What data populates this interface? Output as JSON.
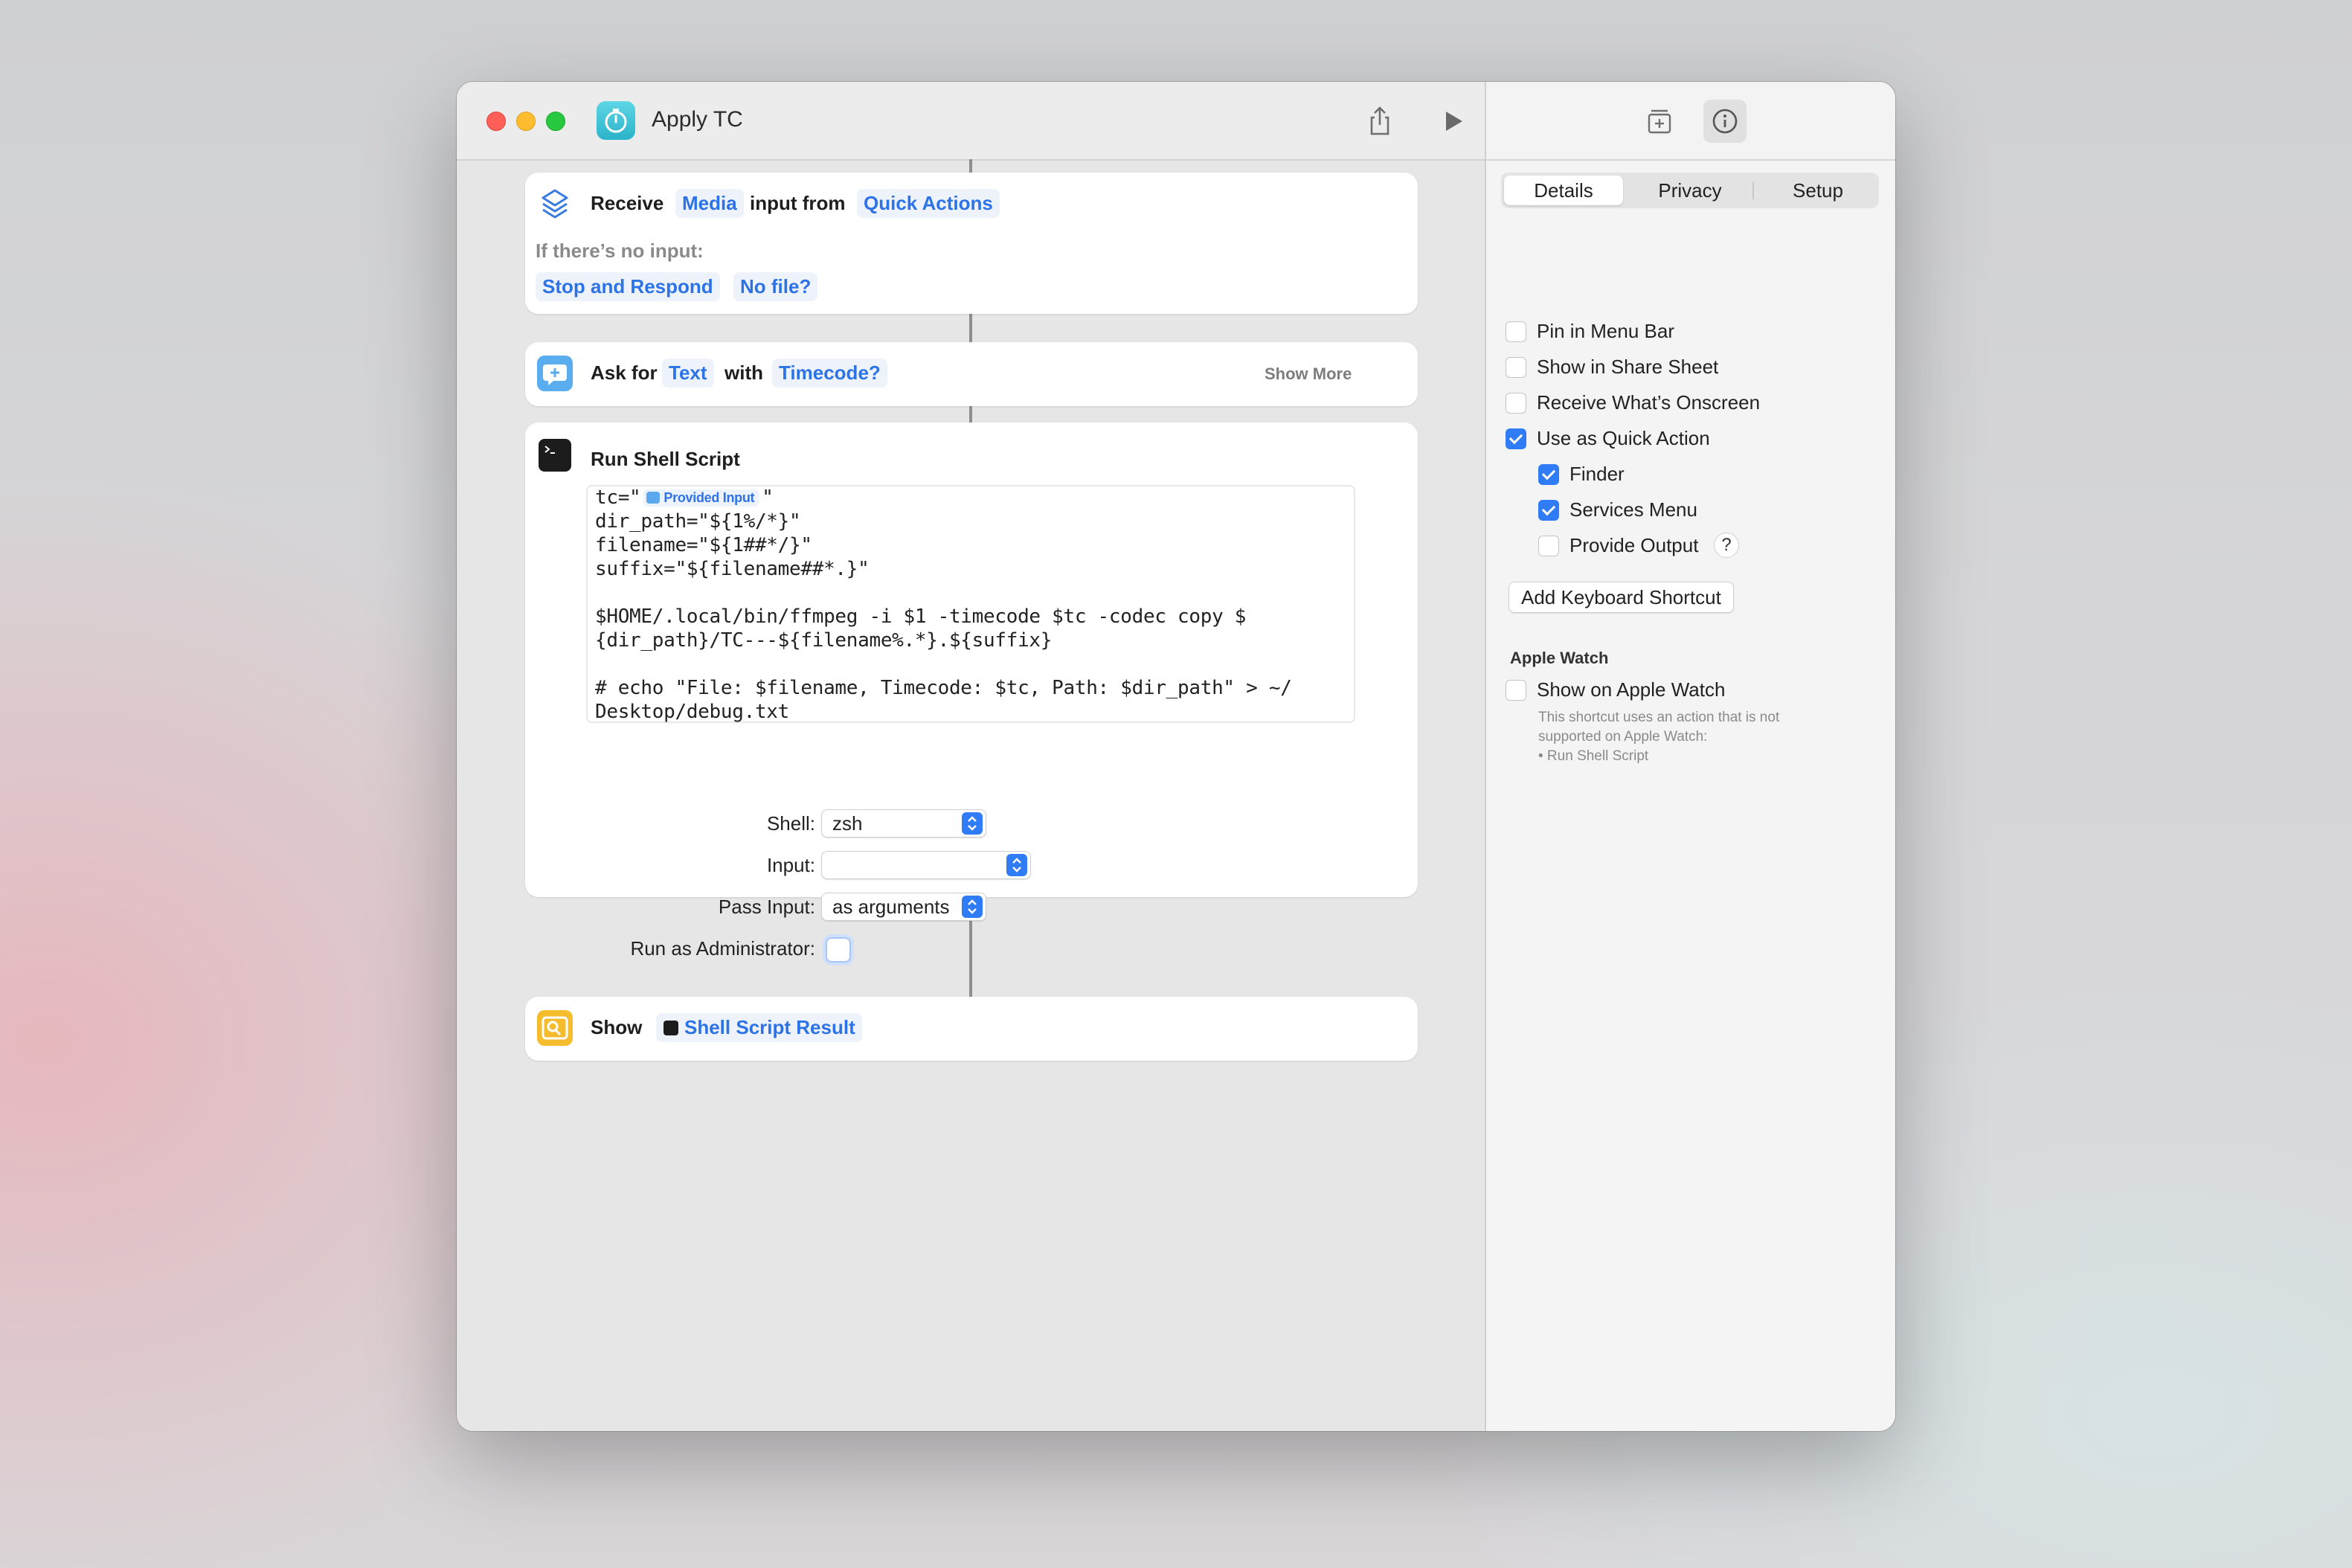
{
  "window": {
    "title": "Apply TC"
  },
  "actions": {
    "receive": {
      "label": "Receive",
      "type_token": "Media",
      "from_label": "input from",
      "source_token": "Quick Actions",
      "no_input_label": "If there’s no input:",
      "stop_token": "Stop and Respond",
      "no_file_token": "No file?"
    },
    "ask": {
      "label": "Ask for",
      "type_token": "Text",
      "with_label": "with",
      "prompt_token": "Timecode?",
      "show_more": "Show More"
    },
    "shell": {
      "title": "Run Shell Script",
      "code": {
        "line1_pre": "tc=\"",
        "line1_badge": "Provided Input",
        "line1_post": "\"",
        "line2": "dir_path=\"${1%/*}\"",
        "line3": "filename=\"${1##*/}\"",
        "line4": "suffix=\"${filename##*.}\"",
        "line5": "$HOME/.local/bin/ffmpeg -i $1 -timecode $tc -codec copy $",
        "line6": "{dir_path}/TC---${filename%.*}.${suffix}",
        "line7": "# echo \"File: $filename, Timecode: $tc, Path: $dir_path\" > ~/",
        "line8": "Desktop/debug.txt"
      },
      "shell_label": "Shell:",
      "shell_value": "zsh",
      "input_label": "Input:",
      "input_value": "",
      "pass_label": "Pass Input:",
      "pass_value": "as arguments",
      "admin_label": "Run as Administrator:"
    },
    "show": {
      "label": "Show",
      "token": "Shell Script Result"
    }
  },
  "sidebar": {
    "tabs": [
      "Details",
      "Privacy",
      "Setup"
    ],
    "active_tab": "Details",
    "options": [
      {
        "label": "Pin in Menu Bar",
        "checked": false
      },
      {
        "label": "Show in Share Sheet",
        "checked": false
      },
      {
        "label": "Receive What’s Onscreen",
        "checked": false
      },
      {
        "label": "Use as Quick Action",
        "checked": true
      },
      {
        "label": "Finder",
        "checked": true
      },
      {
        "label": "Services Menu",
        "checked": true
      },
      {
        "label": "Provide Output",
        "checked": false
      }
    ],
    "help_glyph": "?",
    "add_shortcut": "Add Keyboard Shortcut",
    "watch_heading": "Apple Watch",
    "watch_option": {
      "label": "Show on Apple Watch",
      "checked": false
    },
    "watch_note_1": "This shortcut uses an action that is not",
    "watch_note_2": "supported on Apple Watch:",
    "watch_note_3": "• Run Shell Script"
  },
  "colors": {
    "accent": "#2f7cf6",
    "token_text": "#2d73e8",
    "red_light": "#ff5f57",
    "yellow_light": "#febc2e",
    "green_light": "#28c840"
  },
  "icons": {
    "app": "stopwatch-icon",
    "share": "share-icon",
    "run": "play-icon",
    "library": "add-library-icon",
    "info": "info-icon"
  }
}
